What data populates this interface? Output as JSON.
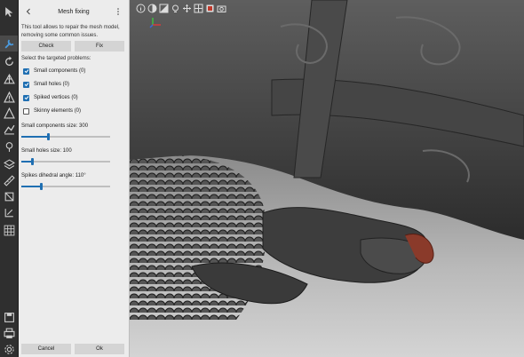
{
  "panel": {
    "title": "Mesh fixing",
    "description": "This tool allows to repair the mesh model, removing some common issues.",
    "tabs": {
      "check": "Check",
      "fix": "Fix"
    },
    "problems_label": "Select the targeted problems:",
    "problems": [
      {
        "label": "Small components (0)",
        "checked": true
      },
      {
        "label": "Small holes (0)",
        "checked": true
      },
      {
        "label": "Spiked vertices (0)",
        "checked": true
      },
      {
        "label": "Skinny elements (0)",
        "checked": false
      }
    ],
    "sliders": [
      {
        "label": "Small components size: 300",
        "value_fraction": 0.3
      },
      {
        "label": "Small holes size: 100",
        "value_fraction": 0.12
      },
      {
        "label": "Spikes dihedral angle: 110°",
        "value_fraction": 0.22
      }
    ],
    "footer": {
      "cancel": "Cancel",
      "ok": "Ok"
    }
  },
  "toolbar_icons": [
    "select-icon",
    "tools-icon",
    "rotate-icon",
    "mesh-icon",
    "warning-icon",
    "triangle-icon",
    "sculpt-icon",
    "pin-icon",
    "layers-icon",
    "measure-icon",
    "transform-icon",
    "texture-icon",
    "grid-icon",
    "save-icon",
    "print-icon",
    "settings-icon"
  ],
  "viewport_icons": [
    "info-icon",
    "shading-icon",
    "wireframe-icon",
    "light-icon",
    "move-icon",
    "grid-view-icon",
    "frame-icon",
    "camera-icon"
  ],
  "colors": {
    "accent": "#1f6fb2",
    "panel_bg": "#ececec",
    "toolbar_bg": "#2f2f2f"
  }
}
